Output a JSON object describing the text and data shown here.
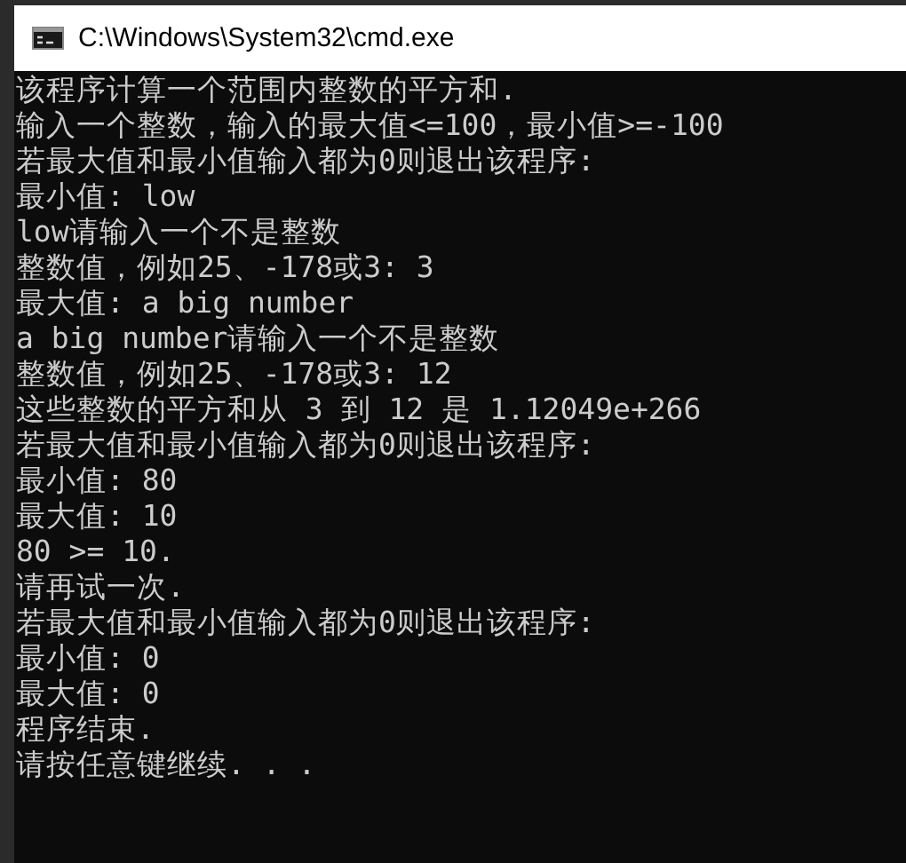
{
  "window": {
    "title": "C:\\Windows\\System32\\cmd.exe"
  },
  "console": {
    "lines": [
      "该程序计算一个范围内整数的平方和.",
      "输入一个整数，输入的最大值<=100，最小值>=-100",
      "若最大值和最小值输入都为0则退出该程序:",
      "最小值: low",
      "low请输入一个不是整数",
      "整数值，例如25、-178或3: 3",
      "最大值: a big number",
      "a big number请输入一个不是整数",
      "整数值，例如25、-178或3: 12",
      "这些整数的平方和从 3 到 12 是 1.12049e+266",
      "若最大值和最小值输入都为0则退出该程序:",
      "最小值: 80",
      "最大值: 10",
      "80 >= 10.",
      "请再试一次.",
      "若最大值和最小值输入都为0则退出该程序:",
      "最小值: 0",
      "最大值: 0",
      "程序结束.",
      "请按任意键继续. . ."
    ]
  }
}
